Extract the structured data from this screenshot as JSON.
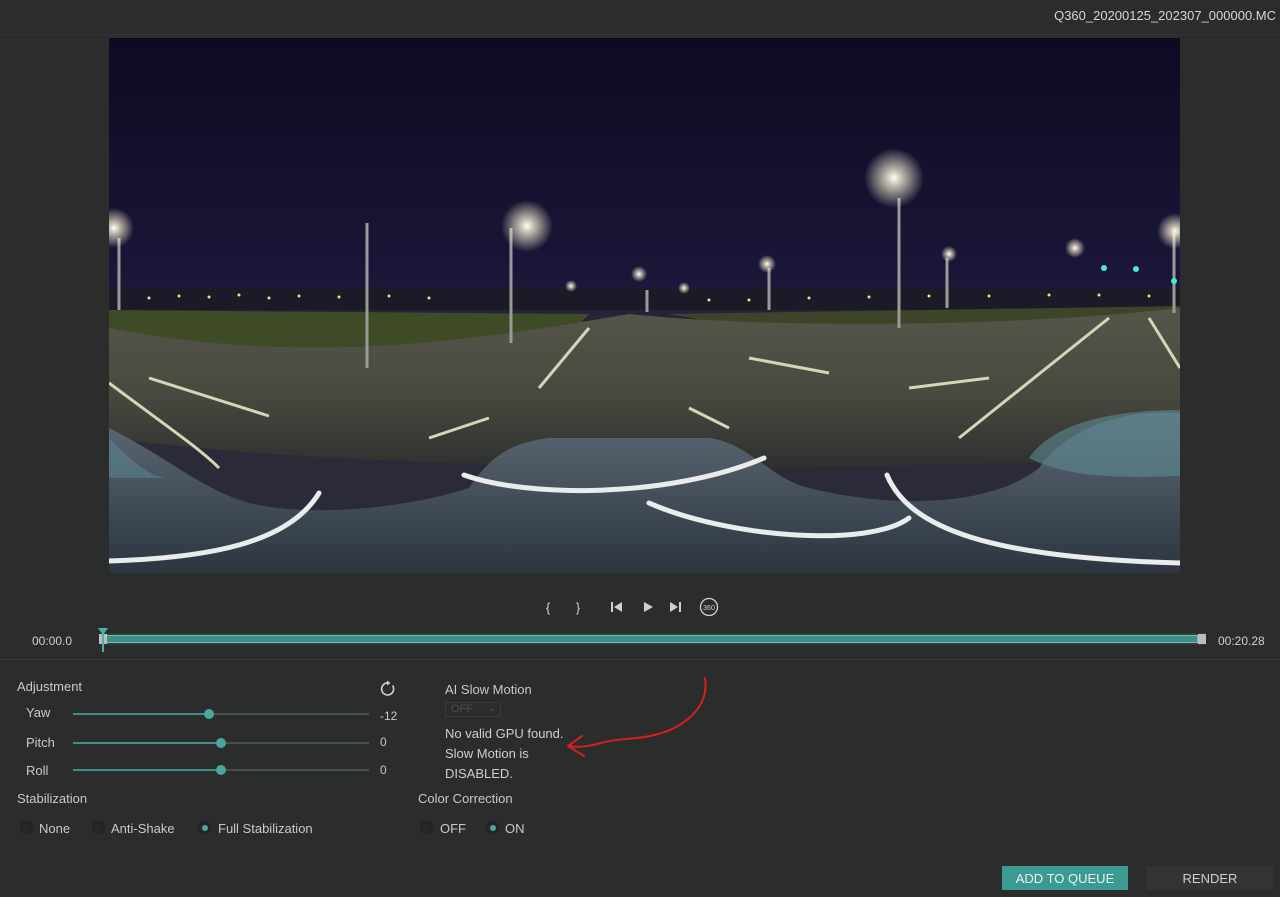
{
  "window": {
    "file_title": "Q360_20200125_202307_000000.MC"
  },
  "transport": {
    "mark_in_label": "{",
    "mark_out_label": "}",
    "prev_label": "⏮",
    "play_label": "▶",
    "next_label": "⏭",
    "view360_label": "360"
  },
  "timeline": {
    "start_time": "00:00.0",
    "end_time": "00:20.28",
    "playhead_fraction": 0.0
  },
  "adjustment": {
    "title": "Adjustment",
    "reset_icon": "reset-icon",
    "sliders": [
      {
        "label": "Yaw",
        "value": "-12",
        "fraction": 0.46
      },
      {
        "label": "Pitch",
        "value": "0",
        "fraction": 0.5
      },
      {
        "label": "Roll",
        "value": "0",
        "fraction": 0.5
      }
    ]
  },
  "ai_slow_motion": {
    "title": "AI Slow Motion",
    "select_value": "OFF",
    "message_line1": "No valid GPU found.",
    "message_line2": "Slow Motion is",
    "message_line3": "DISABLED."
  },
  "stabilization": {
    "title": "Stabilization",
    "options": [
      "None",
      "Anti-Shake",
      "Full Stabilization"
    ],
    "selected": "Full Stabilization"
  },
  "color_correction": {
    "title": "Color Correction",
    "options": [
      "OFF",
      "ON"
    ],
    "selected": "ON"
  },
  "actions": {
    "add_to_queue": "ADD TO QUEUE",
    "render": "RENDER"
  },
  "colors": {
    "accent": "#3b9b93",
    "background": "#2b2c2c",
    "annotation": "#d42020"
  }
}
